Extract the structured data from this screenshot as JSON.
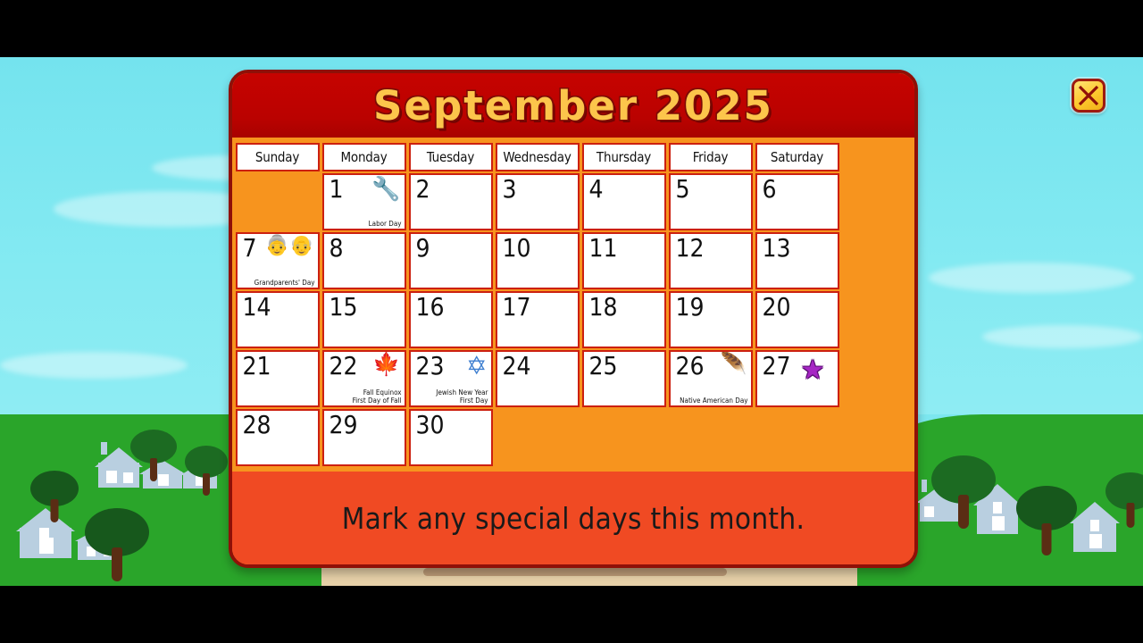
{
  "window": {
    "close_icon": "close-x-icon"
  },
  "calendar": {
    "title": "September 2025",
    "weekday_headers": [
      "Sunday",
      "Monday",
      "Tuesday",
      "Wednesday",
      "Thursday",
      "Friday",
      "Saturday"
    ],
    "weeks": [
      [
        {
          "day": "",
          "empty": true
        },
        {
          "day": "1",
          "icon": "wrench-icon",
          "glyph": "🔧",
          "label": "Labor Day"
        },
        {
          "day": "2"
        },
        {
          "day": "3"
        },
        {
          "day": "4"
        },
        {
          "day": "5"
        },
        {
          "day": "6"
        }
      ],
      [
        {
          "day": "7",
          "icon": "elderly-couple-icon",
          "glyph": "👵👴",
          "label": "Grandparents' Day"
        },
        {
          "day": "8"
        },
        {
          "day": "9"
        },
        {
          "day": "10"
        },
        {
          "day": "11"
        },
        {
          "day": "12"
        },
        {
          "day": "13"
        }
      ],
      [
        {
          "day": "14"
        },
        {
          "day": "15"
        },
        {
          "day": "16"
        },
        {
          "day": "17"
        },
        {
          "day": "18"
        },
        {
          "day": "19"
        },
        {
          "day": "20"
        }
      ],
      [
        {
          "day": "21"
        },
        {
          "day": "22",
          "icon": "autumn-tree-icon",
          "glyph": "🍁",
          "label": "Fall Equinox\nFirst Day of Fall"
        },
        {
          "day": "23",
          "icon": "star-of-david-icon",
          "glyph": "✡",
          "label": "Jewish New Year\nFirst Day"
        },
        {
          "day": "24"
        },
        {
          "day": "25"
        },
        {
          "day": "26",
          "icon": "headdress-icon",
          "glyph": "🪶",
          "label": "Native American Day"
        },
        {
          "day": "27",
          "icon": "purple-star-mark-icon",
          "glyph": "★",
          "label": ""
        }
      ],
      [
        {
          "day": "28"
        },
        {
          "day": "29"
        },
        {
          "day": "30"
        },
        {
          "day": "",
          "empty": true
        },
        {
          "day": "",
          "empty": true
        },
        {
          "day": "",
          "empty": true
        },
        {
          "day": "",
          "empty": true
        }
      ]
    ],
    "instruction": "Mark any special days this month."
  },
  "colors": {
    "header_red": "#bb0200",
    "panel_orange": "#f7941e",
    "instruction_orange": "#f04a23",
    "title_gold": "#fcc54b",
    "cell_border_red": "#cc2010",
    "sky_cyan": "#7ce6ef",
    "grass_green": "#2aa52a",
    "ground_tan": "#e6d0a8",
    "star_purple": "#a626c4"
  }
}
